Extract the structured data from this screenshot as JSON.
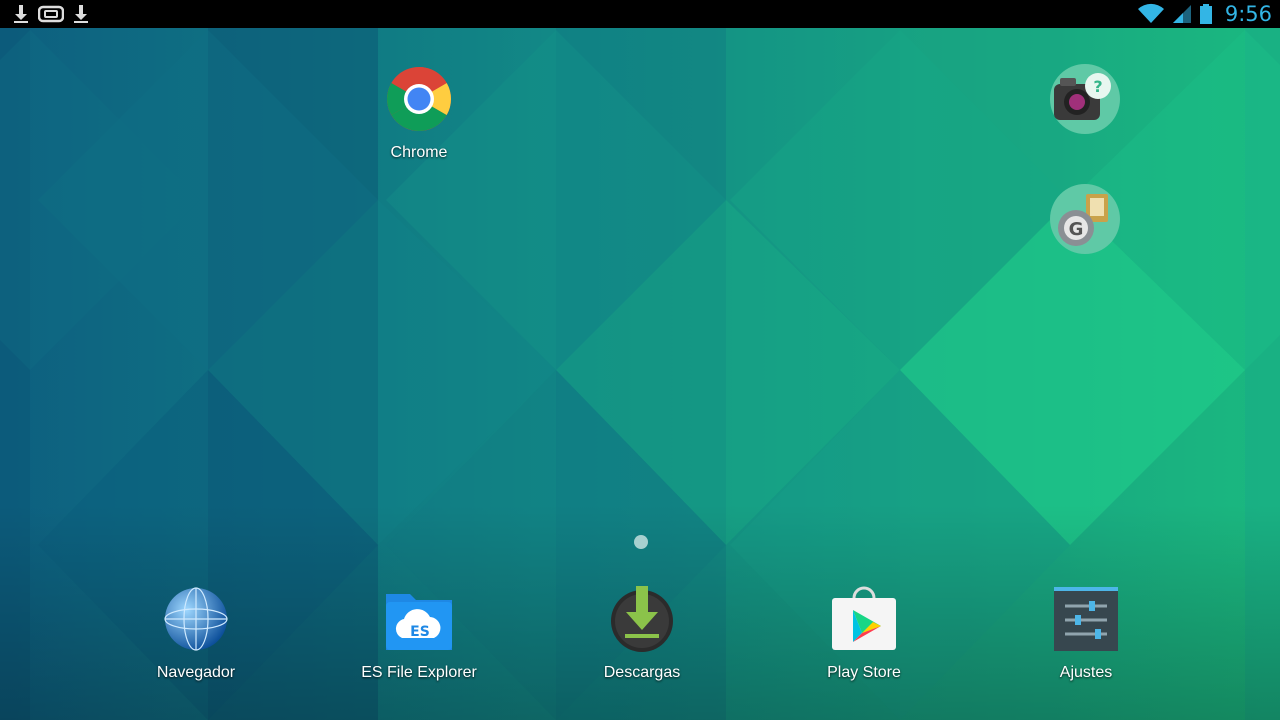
{
  "status_bar": {
    "left_icons": [
      "download-icon",
      "bb-tablet-icon",
      "download-icon"
    ],
    "right_icons": [
      "wifi-icon",
      "signal-icon",
      "battery-icon"
    ],
    "time": "9:56",
    "accent_color": "#33b5e5"
  },
  "home": {
    "top_apps": [
      {
        "name": "chrome",
        "label": "Chrome",
        "icon": "chrome-icon"
      }
    ],
    "right_shortcuts": [
      {
        "icon": "camera-help-icon"
      },
      {
        "icon": "google-settings-icon"
      }
    ],
    "page_indicator": {
      "pages": 1,
      "current": 1
    },
    "dock": [
      {
        "label": "Navegador",
        "icon": "globe-icon"
      },
      {
        "label": "ES File Explorer",
        "icon": "es-file-explorer-icon"
      },
      {
        "label": "Descargas",
        "icon": "downloads-icon"
      },
      {
        "label": "Play Store",
        "icon": "play-store-icon"
      },
      {
        "label": "Ajustes",
        "icon": "settings-icon"
      }
    ]
  },
  "colors": {
    "wallpaper_dark": "#0d5a7a",
    "wallpaper_mid": "#16908a",
    "wallpaper_light": "#1fcf8a"
  }
}
